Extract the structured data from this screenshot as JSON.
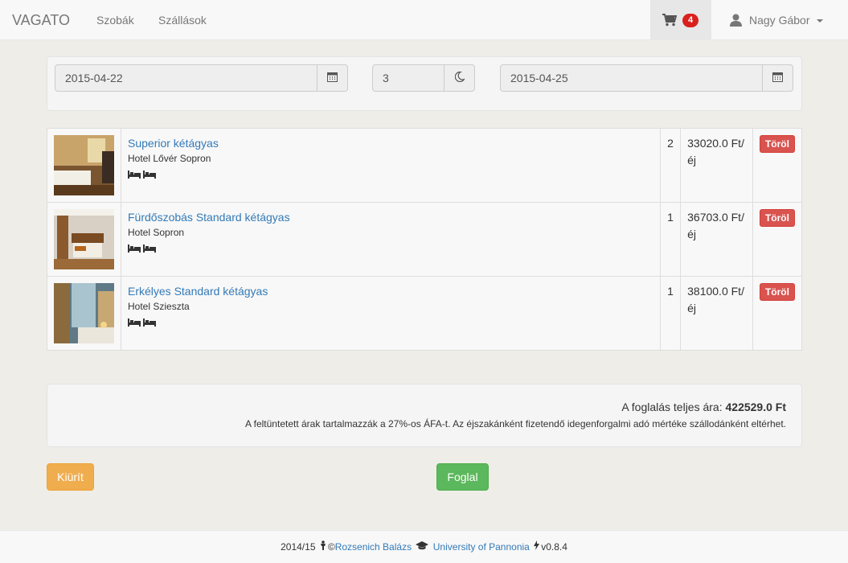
{
  "navbar": {
    "brand": "VAGATO",
    "links": [
      "Szobák",
      "Szállások"
    ],
    "cart_count": "4",
    "user_name": "Nagy Gábor"
  },
  "dates": {
    "checkin": "2015-04-22",
    "nights": "3",
    "checkout": "2015-04-25"
  },
  "cart_items": [
    {
      "room": "Superior kétágyas",
      "hotel": "Hotel Lővér Sopron",
      "qty": "2",
      "price": "33020.0 Ft/",
      "unit": "éj",
      "delete_label": "Töröl"
    },
    {
      "room": "Fürdőszobás Standard kétágyas",
      "hotel": "Hotel Sopron",
      "qty": "1",
      "price": "36703.0 Ft/",
      "unit": "éj",
      "delete_label": "Töröl"
    },
    {
      "room": "Erkélyes Standard kétágyas",
      "hotel": "Hotel Szieszta",
      "qty": "1",
      "price": "38100.0 Ft/",
      "unit": "éj",
      "delete_label": "Töröl"
    }
  ],
  "summary": {
    "total_label": "A foglalás teljes ára:",
    "total_value": "422529.0 Ft",
    "vat_note": "A feltüntetett árak tartalmazzák a 27%-os ÁFA-t. Az éjszakánként fizetendő idegenforgalmi adó mértéke szállodánként eltérhet."
  },
  "actions": {
    "clear_label": "Kiürít",
    "book_label": "Foglal"
  },
  "footer": {
    "year": "2014/15",
    "copyright": "©",
    "author": "Rozsenich Balázs",
    "university": "University of Pannonia",
    "version": "v0.8.4"
  },
  "icons": {
    "cart": "shopping-cart-icon",
    "user": "user-icon",
    "calendar": "calendar-icon",
    "moon": "moon-icon",
    "bed": "bed-icon"
  }
}
